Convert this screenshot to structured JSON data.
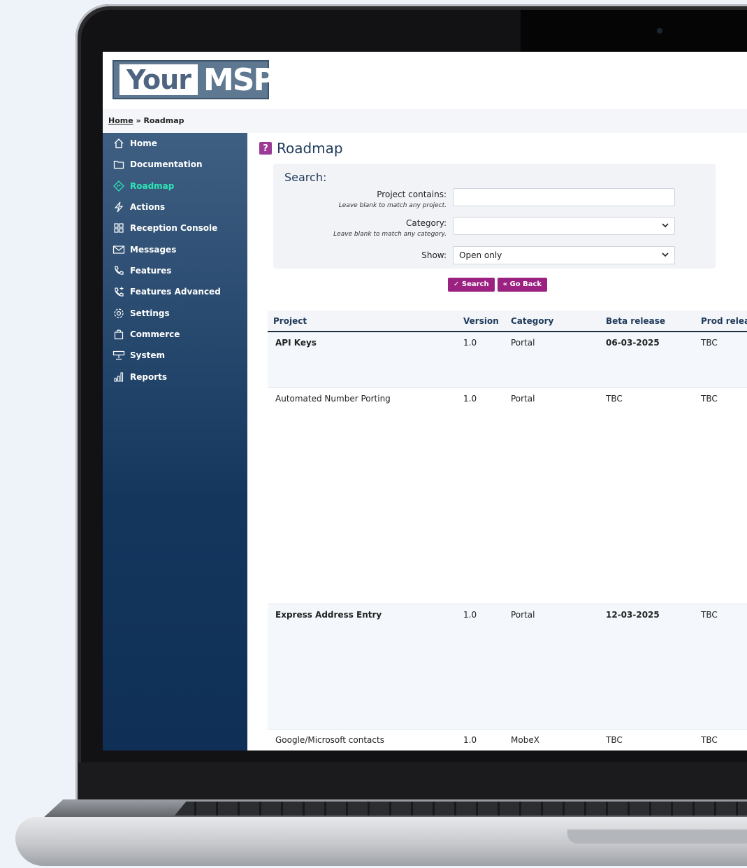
{
  "brand": {
    "logo_part1": "Your",
    "logo_part2": "MSP"
  },
  "breadcrumb": {
    "home": "Home",
    "separator": " » ",
    "current": "Roadmap"
  },
  "sidebar": {
    "items": [
      {
        "label": "Home",
        "icon": "home-icon"
      },
      {
        "label": "Documentation",
        "icon": "folder-icon"
      },
      {
        "label": "Roadmap",
        "icon": "roadmap-icon",
        "active": true
      },
      {
        "label": "Actions",
        "icon": "lightning-icon"
      },
      {
        "label": "Reception Console",
        "icon": "grid-icon"
      },
      {
        "label": "Messages",
        "icon": "envelope-icon"
      },
      {
        "label": "Features",
        "icon": "phone-icon"
      },
      {
        "label": "Features Advanced",
        "icon": "phone-plus-icon"
      },
      {
        "label": "Settings",
        "icon": "gear-icon"
      },
      {
        "label": "Commerce",
        "icon": "bag-icon"
      },
      {
        "label": "System",
        "icon": "system-icon"
      },
      {
        "label": "Reports",
        "icon": "bar-chart-icon"
      }
    ]
  },
  "page": {
    "title": "Roadmap",
    "help_icon": "?"
  },
  "search": {
    "heading": "Search:",
    "project_label": "Project contains:",
    "project_hint": "Leave blank to match any project.",
    "project_value": "",
    "category_label": "Category:",
    "category_hint": "Leave blank to match any category.",
    "category_value": "",
    "show_label": "Show:",
    "show_value": "Open only",
    "search_button": "✓ Search",
    "back_button": "« Go Back"
  },
  "table": {
    "headers": {
      "project": "Project",
      "version": "Version",
      "category": "Category",
      "beta": "Beta release",
      "prod": "Prod releas"
    },
    "rows": [
      {
        "project": "API Keys",
        "version": "1.0",
        "category": "Portal",
        "beta": "06-03-2025",
        "prod": "TBC"
      },
      {
        "project": "Automated Number Porting",
        "version": "1.0",
        "category": "Portal",
        "beta": "TBC",
        "prod": "TBC"
      },
      {
        "project": "Express Address Entry",
        "version": "1.0",
        "category": "Portal",
        "beta": "12-03-2025",
        "prod": "TBC"
      },
      {
        "project": "Google/Microsoft contacts",
        "version": "1.0",
        "category": "MobeX",
        "beta": "TBC",
        "prod": "TBC"
      }
    ]
  },
  "colors": {
    "sidebar_top": "#3f5f82",
    "sidebar_bottom": "#0f2f56",
    "active_nav": "#2ee3b6",
    "button": "#9b2281",
    "help_badge": "#9c3a97"
  }
}
